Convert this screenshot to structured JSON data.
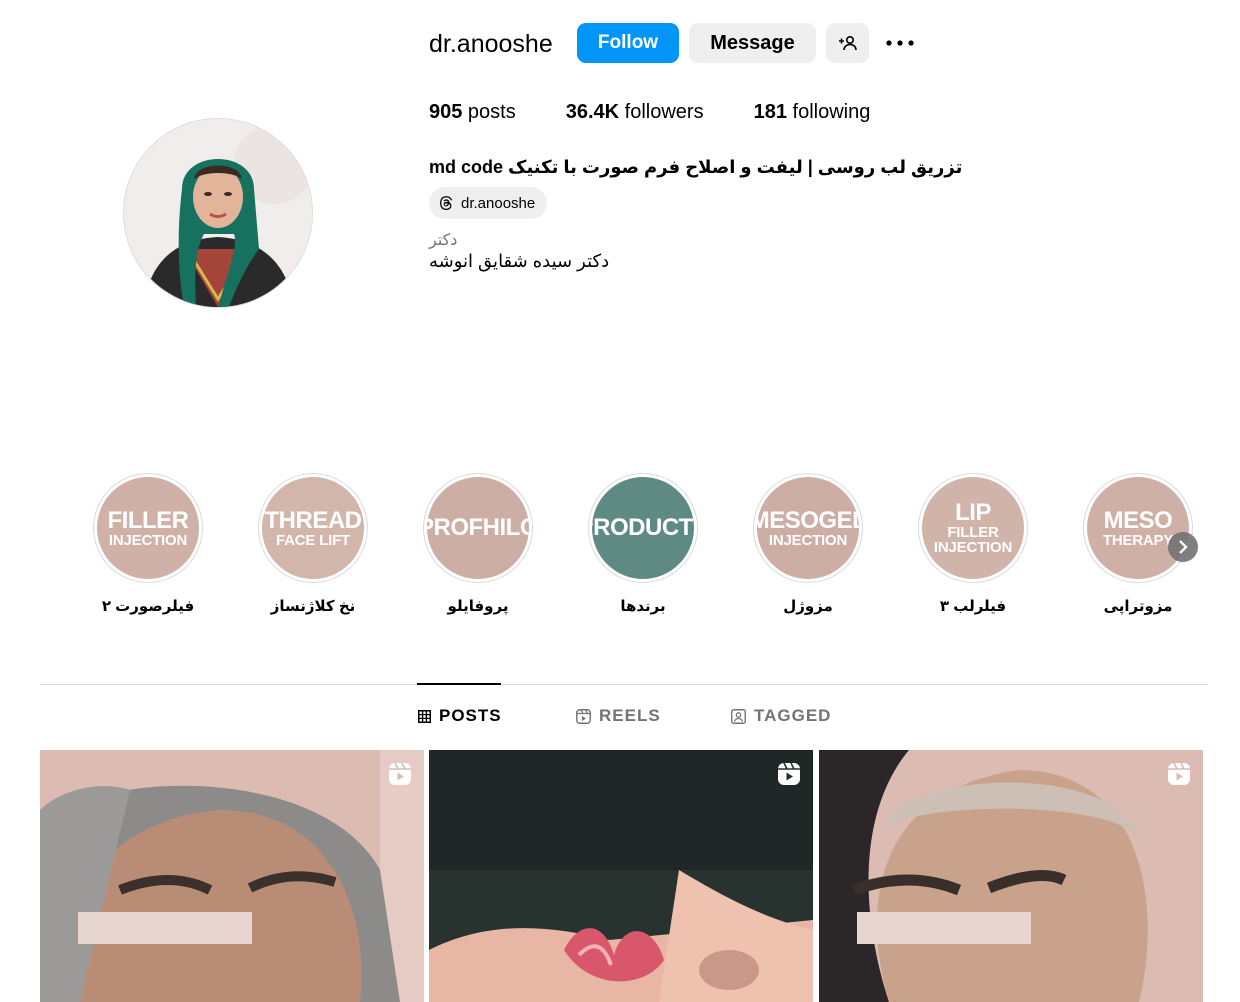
{
  "profile": {
    "username": "dr.anooshe",
    "follow_label": "Follow",
    "message_label": "Message",
    "stats": {
      "posts_count": "905",
      "posts_label": " posts",
      "followers_count": "36.4K",
      "followers_label": " followers",
      "following_count": "181",
      "following_label": " following"
    },
    "bio": "تزریق لب روسی | لیفت و اصلاح فرم صورت با تکنیک md code",
    "threads_handle": "dr.anooshe",
    "category": "دکتر",
    "full_name": "دکتر سیده شقایق انوشه"
  },
  "highlights": [
    {
      "title_line1": "FILLER",
      "title_line2": "INJECTION",
      "label": "فیلرصورت ۲",
      "bg": "#cfb1a7"
    },
    {
      "title_line1": "THREAD",
      "title_line2": "FACE LIFT",
      "label": "نخ کلاژنساز",
      "bg": "#d2b5ab"
    },
    {
      "title_line1": "PROFHILO",
      "title_line2": "",
      "label": "پروفایلو",
      "bg": "#cdaea4"
    },
    {
      "title_line1": "PRODUCTS",
      "title_line2": "",
      "label": "برندها",
      "bg": "#5f8a83"
    },
    {
      "title_line1": "MESOGEL",
      "title_line2": "INJECTION",
      "label": "مزوژل",
      "bg": "#ccaea5"
    },
    {
      "title_line1": "LIP",
      "title_line2": "FILLER INJECTION",
      "label": "فیلرلب ۳",
      "bg": "#d0b3a9"
    },
    {
      "title_line1": "MESO",
      "title_line2": "THERAPY",
      "label": "مزوتراپی",
      "bg": "#cfb0a6"
    }
  ],
  "tabs": [
    {
      "label": "POSTS",
      "icon": "grid-icon",
      "active": true
    },
    {
      "label": "REELS",
      "icon": "reels-icon",
      "active": false
    },
    {
      "label": "TAGGED",
      "icon": "tagged-icon",
      "active": false
    }
  ],
  "colors": {
    "accent": "#0095f6",
    "post_bg": "#dcbcb2"
  }
}
